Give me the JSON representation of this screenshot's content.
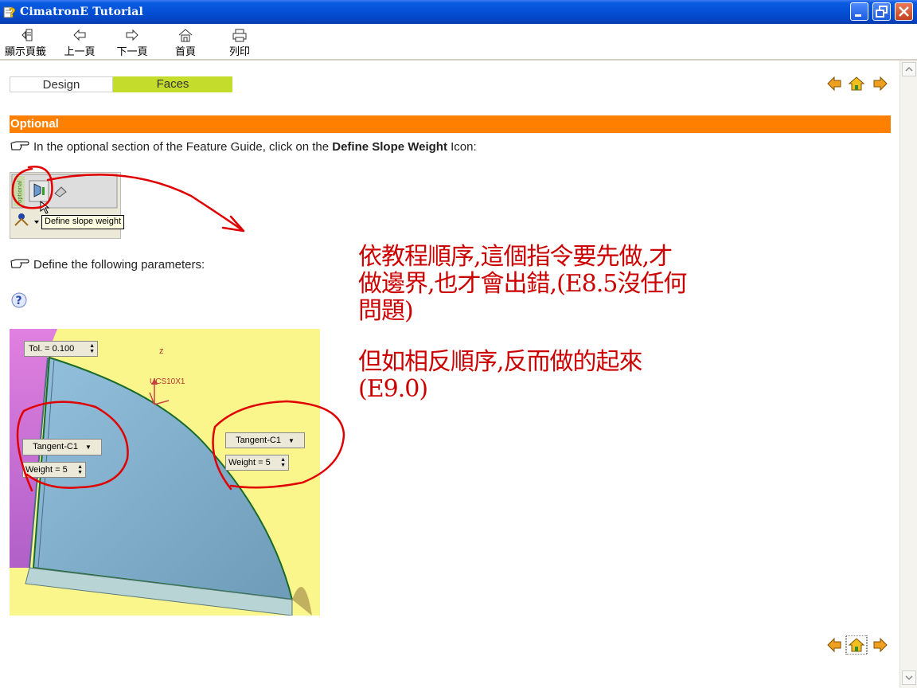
{
  "window": {
    "title": "CimatronE Tutorial"
  },
  "toolbar": {
    "items": [
      {
        "label": "顯示頁籤",
        "icon": "show-tabs-icon"
      },
      {
        "label": "上一頁",
        "icon": "back-arrow-icon"
      },
      {
        "label": "下一頁",
        "icon": "forward-arrow-icon"
      },
      {
        "label": "首頁",
        "icon": "home-icon"
      },
      {
        "label": "列印",
        "icon": "print-icon"
      }
    ]
  },
  "tabs": {
    "design": "Design",
    "faces": "Faces"
  },
  "section": {
    "title": "Optional",
    "instruction_pre": "In the optional section of the Feature Guide, click on the ",
    "instruction_bold": "Define Slope Weight",
    "instruction_post": " Icon:",
    "tooltip": "Define slope  weight",
    "params_text": "Define the following parameters:"
  },
  "scene": {
    "tol_label": "Tol. =   0.100",
    "tangent_left": "Tangent-C1",
    "weight_left": "Weight = 5",
    "tangent_right": "Tangent-C1",
    "weight_right": "Weight = 5",
    "axis_z": "z",
    "ucs": "UCS10X1"
  },
  "annotation": {
    "line1": "依教程順序,這個指令要先做,才",
    "line2": "做邊界,也才會出錯,(E8.5沒任何",
    "line3": "問題)",
    "line4": "但如相反順序,反而做的起來",
    "line5": "(E9.0)"
  },
  "colors": {
    "title_bar": "#0550d6",
    "section_bar": "#ff8000",
    "faces_tab": "#c4dc2c",
    "annotation": "#cc0000"
  }
}
